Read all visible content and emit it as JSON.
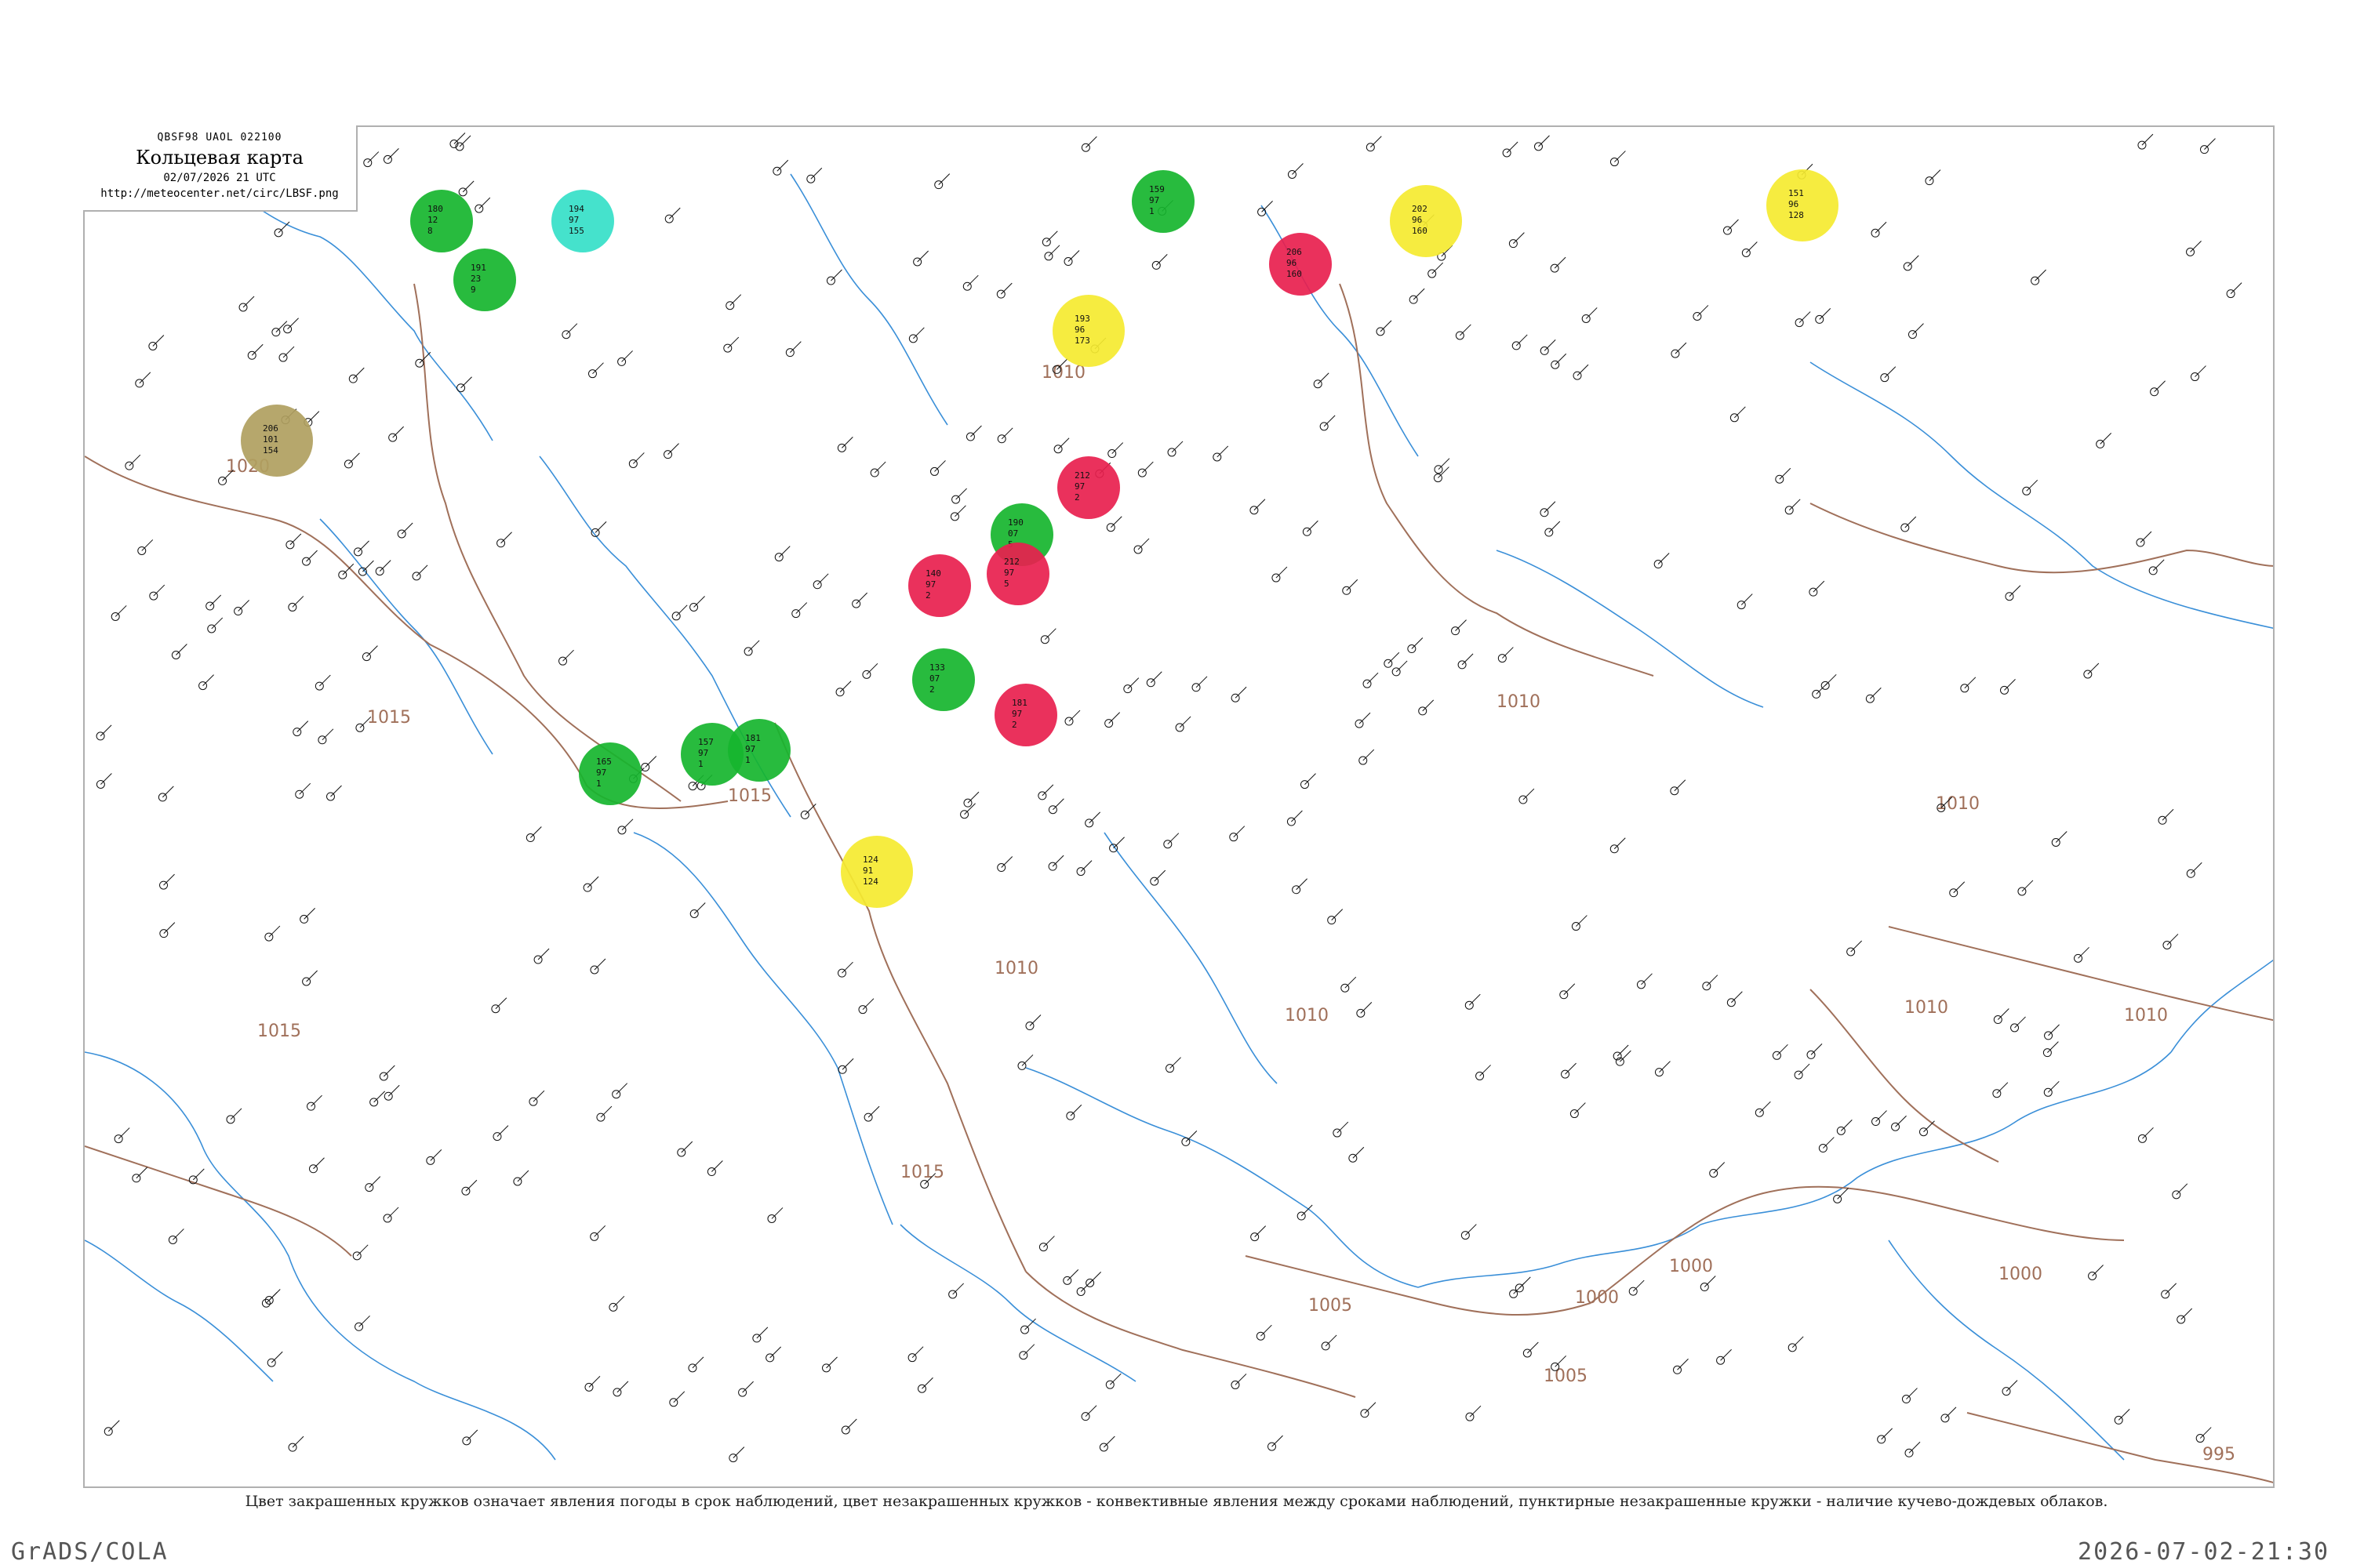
{
  "header": {
    "code": "QBSF98  UAOL  022100",
    "title": "Кольцевая карта",
    "datetime": "02/07/2026 21 UTC",
    "url": "http://meteocenter.net/circ/LBSF.png"
  },
  "caption": "Цвет закрашенных кружков означает явления погоды в срок наблюдений, цвет незакрашенных кружков - конвективные явления между сроками наблюдений, пунктирные незакрашенные кружки - наличие кучево-дождевых облаков.",
  "footer": {
    "left": "GrADS/COLA",
    "right": "2026-07-02-21:30"
  },
  "colors": {
    "coast": "#3a8fd8",
    "isobar": "#a0705a",
    "frame": "#b0b0b0",
    "rain": "#16b52e",
    "thunder": "#e8204e",
    "cyan": "#35e0c8",
    "yellow": "#f5ea30",
    "olive": "#b0a060"
  },
  "isobar_labels": [
    "1020",
    "1015",
    "1015",
    "1015",
    "1010",
    "1010",
    "1010",
    "1010",
    "1010",
    "1010",
    "1005",
    "1005",
    "1000",
    "1000",
    "1000",
    "995",
    "1015",
    "1010"
  ],
  "stations": [
    {
      "type": "rain",
      "values": [
        "180",
        "12",
        "8"
      ]
    },
    {
      "type": "rain",
      "values": [
        "191",
        "23",
        "9"
      ]
    },
    {
      "type": "cyan",
      "values": [
        "194",
        "97",
        "155"
      ]
    },
    {
      "type": "rain",
      "values": [
        "159",
        "97",
        "1"
      ]
    },
    {
      "type": "thunder",
      "values": [
        "206",
        "96",
        "160"
      ]
    },
    {
      "type": "yellow",
      "values": [
        "202",
        "96",
        "160"
      ]
    },
    {
      "type": "yellow",
      "values": [
        "193",
        "96",
        "173"
      ]
    },
    {
      "type": "yellow",
      "values": [
        "151",
        "96",
        "128"
      ]
    },
    {
      "type": "olive",
      "values": [
        "206",
        "101",
        "154"
      ]
    },
    {
      "type": "thunder",
      "values": [
        "212",
        "97",
        "2"
      ]
    },
    {
      "type": "rain",
      "values": [
        "190",
        "07",
        "5"
      ]
    },
    {
      "type": "thunder",
      "values": [
        "140",
        "97",
        "2"
      ]
    },
    {
      "type": "thunder",
      "values": [
        "212",
        "97",
        "5"
      ]
    },
    {
      "type": "rain",
      "values": [
        "133",
        "07",
        "2"
      ]
    },
    {
      "type": "thunder",
      "values": [
        "181",
        "97",
        "2"
      ]
    },
    {
      "type": "rain",
      "values": [
        "165",
        "97",
        "1"
      ]
    },
    {
      "type": "rain",
      "values": [
        "157",
        "97",
        "1"
      ]
    },
    {
      "type": "rain",
      "values": [
        "181",
        "97",
        "1"
      ]
    },
    {
      "type": "yellow",
      "values": [
        "124",
        "91",
        "124"
      ]
    }
  ]
}
